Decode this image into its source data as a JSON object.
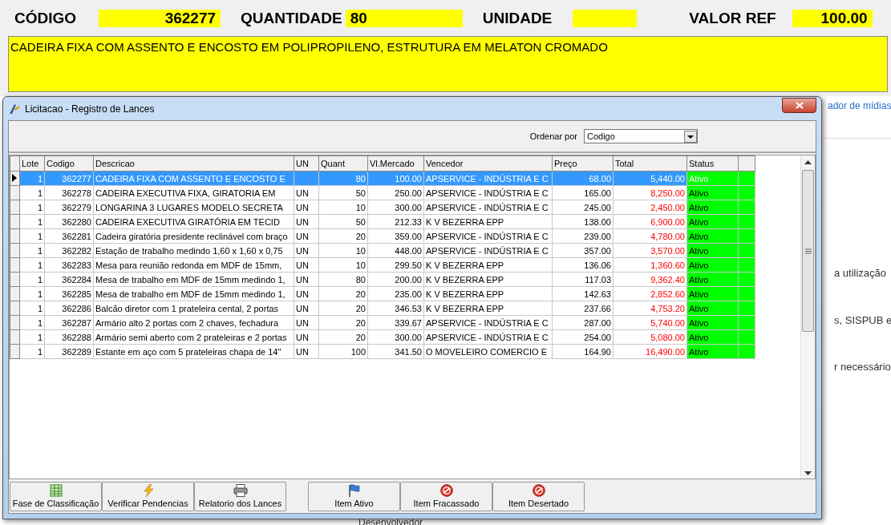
{
  "header": {
    "fields": [
      {
        "label": "CÓDIGO",
        "value": "362277"
      },
      {
        "label": "QUANTIDADE",
        "value": "80"
      },
      {
        "label": "UNIDADE"
      },
      {
        "label": "VALOR REF",
        "value": "100.00"
      }
    ],
    "description": "CADEIRA FIXA COM ASSENTO E ENCOSTO EM POLIPROPILENO, ESTRUTURA EM MELATON CROMADO"
  },
  "background": {
    "link": "ador de mídias",
    "texts": [
      "a utilização",
      "s, SISPUB e",
      "r necessário"
    ],
    "footer": "Desenvolvedor"
  },
  "dialog": {
    "title": "Licitacao - Registro de Lances",
    "sort": {
      "label": "Ordenar por",
      "value": "Codigo"
    },
    "columns": [
      "Lote",
      "Codigo",
      "Descricao",
      "UN",
      "Quant",
      "Vl.Mercado",
      "Vencedor",
      "Preço",
      "Total",
      "Status"
    ],
    "rows": [
      {
        "lote": "1",
        "codigo": "362277",
        "descricao": "CADEIRA FIXA COM ASSENTO E ENCOSTO E",
        "quant": "80",
        "mercado": "100.00",
        "vencedor": "APSERVICE - INDÚSTRIA E C",
        "preco": "68.00",
        "total": "5,440.00",
        "status": "Ativo",
        "selected": true
      },
      {
        "lote": "1",
        "codigo": "362278",
        "descricao": "CADEIRA EXECUTIVA FIXA, GIRATORIA EM",
        "un": "UN",
        "quant": "50",
        "mercado": "250.00",
        "vencedor": "APSERVICE - INDÚSTRIA E C",
        "preco": "165.00",
        "total": "8,250.00",
        "status": "Ativo",
        "selected": false
      },
      {
        "lote": "1",
        "codigo": "362279",
        "descricao": "LONGARINA 3 LUGARES MODELO SECRETA",
        "un": "UN",
        "quant": "10",
        "mercado": "300.00",
        "vencedor": "APSERVICE - INDÚSTRIA E C",
        "preco": "245.00",
        "total": "2,450.00",
        "status": "Ativo",
        "selected": false
      },
      {
        "lote": "1",
        "codigo": "362280",
        "descricao": "CADEIRA EXECUTIVA GIRATÓRIA EM TECID",
        "un": "UN",
        "quant": "50",
        "mercado": "212.33",
        "vencedor": "K V BEZERRA EPP",
        "preco": "138.00",
        "total": "6,900.00",
        "status": "Ativo",
        "selected": false
      },
      {
        "lote": "1",
        "codigo": "362281",
        "descricao": "Cadeira giratória presidente reclinável com braço",
        "un": "UN",
        "quant": "20",
        "mercado": "359.00",
        "vencedor": "APSERVICE - INDÚSTRIA E C",
        "preco": "239.00",
        "total": "4,780.00",
        "status": "Ativo",
        "selected": false
      },
      {
        "lote": "1",
        "codigo": "362282",
        "descricao": "Estação de trabalho medindo 1,60 x 1,60 x 0,75",
        "un": "UN",
        "quant": "10",
        "mercado": "448.00",
        "vencedor": "APSERVICE - INDÚSTRIA E C",
        "preco": "357.00",
        "total": "3,570.00",
        "status": "Ativo",
        "selected": false
      },
      {
        "lote": "1",
        "codigo": "362283",
        "descricao": "Mesa para reunião redonda em MDF de 15mm,",
        "un": "UN",
        "quant": "10",
        "mercado": "299.50",
        "vencedor": "K V BEZERRA EPP",
        "preco": "136.06",
        "total": "1,360.60",
        "status": "Ativo",
        "selected": false
      },
      {
        "lote": "1",
        "codigo": "362284",
        "descricao": "Mesa de trabalho em MDF de 15mm medindo 1,",
        "un": "UN",
        "quant": "80",
        "mercado": "200.00",
        "vencedor": "K V BEZERRA EPP",
        "preco": "117.03",
        "total": "9,362.40",
        "status": "Ativo",
        "selected": false
      },
      {
        "lote": "1",
        "codigo": "362285",
        "descricao": "Mesa de trabalho em MDF de 15mm medindo 1,",
        "un": "UN",
        "quant": "20",
        "mercado": "235.00",
        "vencedor": "K V BEZERRA EPP",
        "preco": "142.63",
        "total": "2,852.60",
        "status": "Ativo",
        "selected": false
      },
      {
        "lote": "1",
        "codigo": "362286",
        "descricao": "Balcão diretor com 1 prateleira cental, 2 portas",
        "un": "UN",
        "quant": "20",
        "mercado": "346.53",
        "vencedor": "K V BEZERRA EPP",
        "preco": "237.66",
        "total": "4,753.20",
        "status": "Ativo",
        "selected": false
      },
      {
        "lote": "1",
        "codigo": "362287",
        "descricao": "Armário alto 2 portas com 2 chaves, fechadura",
        "un": "UN",
        "quant": "20",
        "mercado": "339.67",
        "vencedor": "APSERVICE - INDÚSTRIA E C",
        "preco": "287.00",
        "total": "5,740.00",
        "status": "Ativo",
        "selected": false
      },
      {
        "lote": "1",
        "codigo": "362288",
        "descricao": "Armário semi aberto com 2 prateleiras e 2 portas",
        "un": "UN",
        "quant": "20",
        "mercado": "300.00",
        "vencedor": "APSERVICE - INDÚSTRIA E C",
        "preco": "254.00",
        "total": "5,080.00",
        "status": "Ativo",
        "selected": false
      },
      {
        "lote": "1",
        "codigo": "362289",
        "descricao": "Estante em aço com 5 prateleiras chapa de 14''",
        "un": "UN",
        "quant": "100",
        "mercado": "341.50",
        "vencedor": "O MOVELEIRO COMERCIO E",
        "preco": "164.90",
        "total": "16,490.00",
        "status": "Ativo",
        "selected": false
      }
    ],
    "buttons": [
      {
        "label": "Fase de Classificação",
        "kind": "grid"
      },
      {
        "label": "Verificar Pendencias",
        "kind": "bolt"
      },
      {
        "label": "Relatorio dos Lances",
        "kind": "printer"
      },
      {
        "label": "Item Ativo",
        "kind": "flag"
      },
      {
        "label": "Item Fracassado",
        "kind": "stop"
      },
      {
        "label": "Item Desertado",
        "kind": "stop"
      }
    ]
  }
}
